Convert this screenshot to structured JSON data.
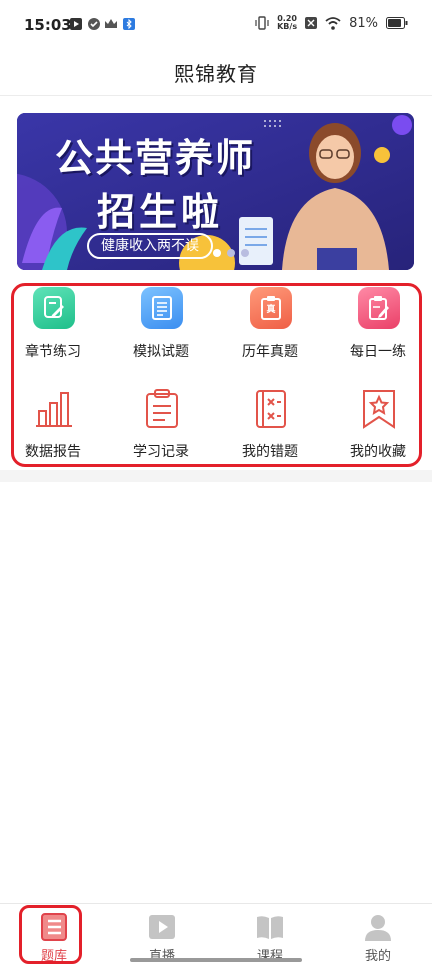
{
  "status_bar": {
    "time": "15:03",
    "net_speed_value": "0.20",
    "net_speed_unit": "KB/s",
    "battery": "81%",
    "left_icons": [
      "play-store-icon",
      "check-shield-icon",
      "crown-icon",
      "bluetooth-app-icon"
    ],
    "right_icons": [
      "vibrate-icon",
      "sim-off-icon",
      "wifi-icon",
      "battery-icon"
    ]
  },
  "header": {
    "title": "熙锦教育"
  },
  "banner": {
    "line1": "公共营养师",
    "line2": "招生啦",
    "pill": "健康收入两不误",
    "colors": {
      "background": "#2f2c8f",
      "accent": "#f7c23a"
    }
  },
  "grid": {
    "items": [
      {
        "label": "章节练习",
        "icon": "pen-note-icon",
        "color": "#2ccf9a"
      },
      {
        "label": "模拟试题",
        "icon": "document-icon",
        "color": "#4aa3f0"
      },
      {
        "label": "历年真题",
        "icon": "clipboard-icon",
        "color": "#f26c4f"
      },
      {
        "label": "每日一练",
        "icon": "edit-clipboard-icon",
        "color": "#f0537a"
      },
      {
        "label": "数据报告",
        "icon": "bar-chart-icon",
        "color": "#e2544a"
      },
      {
        "label": "学习记录",
        "icon": "clipboard-list-icon",
        "color": "#e2544a"
      },
      {
        "label": "我的错题",
        "icon": "error-book-icon",
        "color": "#e2544a"
      },
      {
        "label": "我的收藏",
        "icon": "bookmark-star-icon",
        "color": "#e2544a"
      }
    ],
    "clipboard_badge": "真"
  },
  "tabbar": {
    "tabs": [
      {
        "label": "题库",
        "icon": "question-bank-icon",
        "active": true
      },
      {
        "label": "直播",
        "icon": "play-icon",
        "active": false
      },
      {
        "label": "课程",
        "icon": "book-icon",
        "active": false
      },
      {
        "label": "我的",
        "icon": "user-icon",
        "active": false
      }
    ],
    "active_color": "#e0434b",
    "inactive_color": "#bdbdbd"
  }
}
